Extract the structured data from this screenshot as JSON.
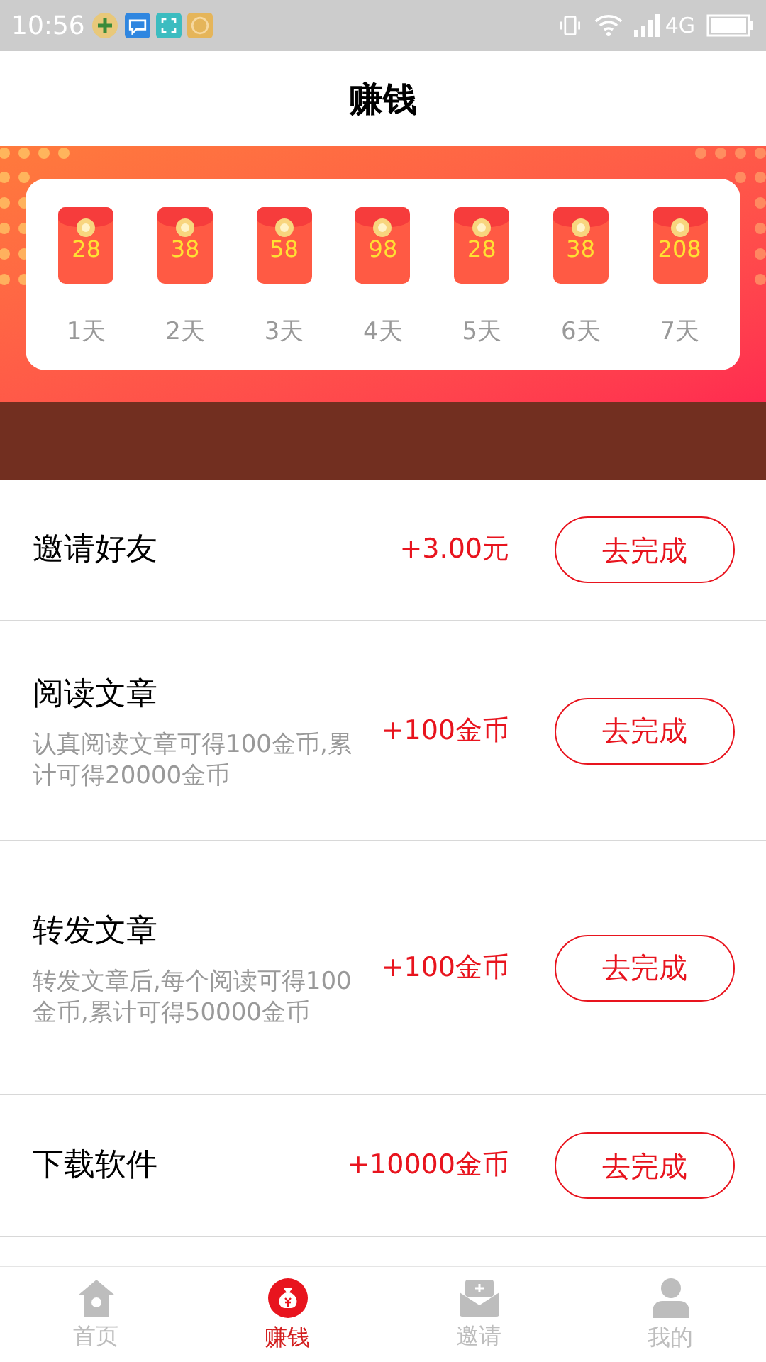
{
  "status_bar": {
    "time": "10:56",
    "network": "4G"
  },
  "header": {
    "title": "赚钱"
  },
  "checkin": [
    {
      "amount": "28",
      "day": "1天"
    },
    {
      "amount": "38",
      "day": "2天"
    },
    {
      "amount": "58",
      "day": "3天"
    },
    {
      "amount": "98",
      "day": "4天"
    },
    {
      "amount": "28",
      "day": "5天"
    },
    {
      "amount": "38",
      "day": "6天"
    },
    {
      "amount": "208",
      "day": "7天"
    }
  ],
  "tasks": [
    {
      "title": "邀请好友",
      "reward": "+3.00元",
      "button": "去完成"
    },
    {
      "title": "阅读文章",
      "description": "认真阅读文章可得100金币,累计可得20000金币",
      "reward": "+100金币",
      "button": "去完成"
    },
    {
      "title": "转发文章",
      "description": "转发文章后,每个阅读可得100金币,累计可得50000金币",
      "reward": "+100金币",
      "button": "去完成"
    },
    {
      "title": "下载软件",
      "reward": "+10000金币",
      "button": "去完成"
    }
  ],
  "tab_bar": [
    {
      "label": "首页",
      "selected": false
    },
    {
      "label": "赚钱",
      "selected": true
    },
    {
      "label": "邀请",
      "selected": false
    },
    {
      "label": "我的",
      "selected": false
    }
  ]
}
